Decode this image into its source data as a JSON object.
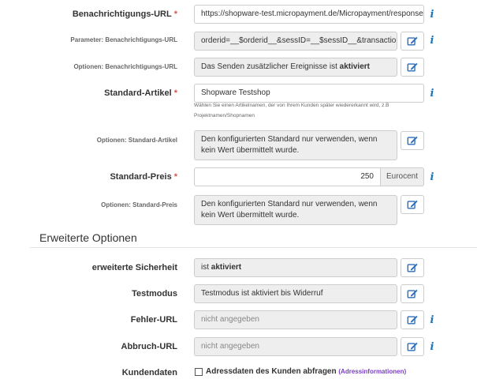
{
  "fields": {
    "notify_url": {
      "label": "Benachrichtigungs-URL",
      "required": "*",
      "value": "https://shopware-test.micropayment.de/Micropayment/response/"
    },
    "notify_params": {
      "label": "Parameter: Benachrichtigungs-URL",
      "value": "orderid=__$orderid__&sessID=__$sessID__&transactionid"
    },
    "notify_options": {
      "label": "Optionen: Benachrichtigungs-URL",
      "value_prefix": "Das Senden zusätzlicher Ereignisse ist ",
      "value_bold": "aktiviert"
    },
    "std_article": {
      "label": "Standard-Artikel",
      "required": "*",
      "value": "Shopware Testshop",
      "help": "Wählen Sie einen Artikelnamen, der von Ihrem Kunden später wiedererkannt wird, z.B Projektnamen/Shopnamen"
    },
    "std_article_options": {
      "label": "Optionen: Standard-Artikel",
      "value": "Den konfigurierten Standard nur verwenden, wenn kein Wert übermittelt wurde."
    },
    "std_price": {
      "label": "Standard-Preis",
      "required": "*",
      "value": "250",
      "unit": "Eurocent"
    },
    "std_price_options": {
      "label": "Optionen: Standard-Preis",
      "value": "Den konfigurierten Standard nur verwenden, wenn kein Wert übermittelt wurde."
    }
  },
  "section": {
    "title": "Erweiterte Optionen"
  },
  "advanced": {
    "security": {
      "label": "erweiterte Sicherheit",
      "value_prefix": "ist ",
      "value_bold": "aktiviert"
    },
    "testmode": {
      "label": "Testmodus",
      "value": "Testmodus ist aktiviert bis Widerruf"
    },
    "error_url": {
      "label": "Fehler-URL",
      "placeholder": "nicht angegeben"
    },
    "abort_url": {
      "label": "Abbruch-URL",
      "placeholder": "nicht angegeben"
    },
    "customer": {
      "label": "Kundendaten",
      "checkbox_label": "Adressdaten des Kunden abfragen",
      "link": "(Adressinformationen)",
      "checked": false
    }
  },
  "icons": {
    "info": "info-icon",
    "edit": "edit-icon",
    "checkbox": "checkbox"
  },
  "colors": {
    "required": "#d9534f",
    "info": "#1b75bb",
    "edit": "#2d6fbf",
    "link": "#7a3fc4"
  }
}
